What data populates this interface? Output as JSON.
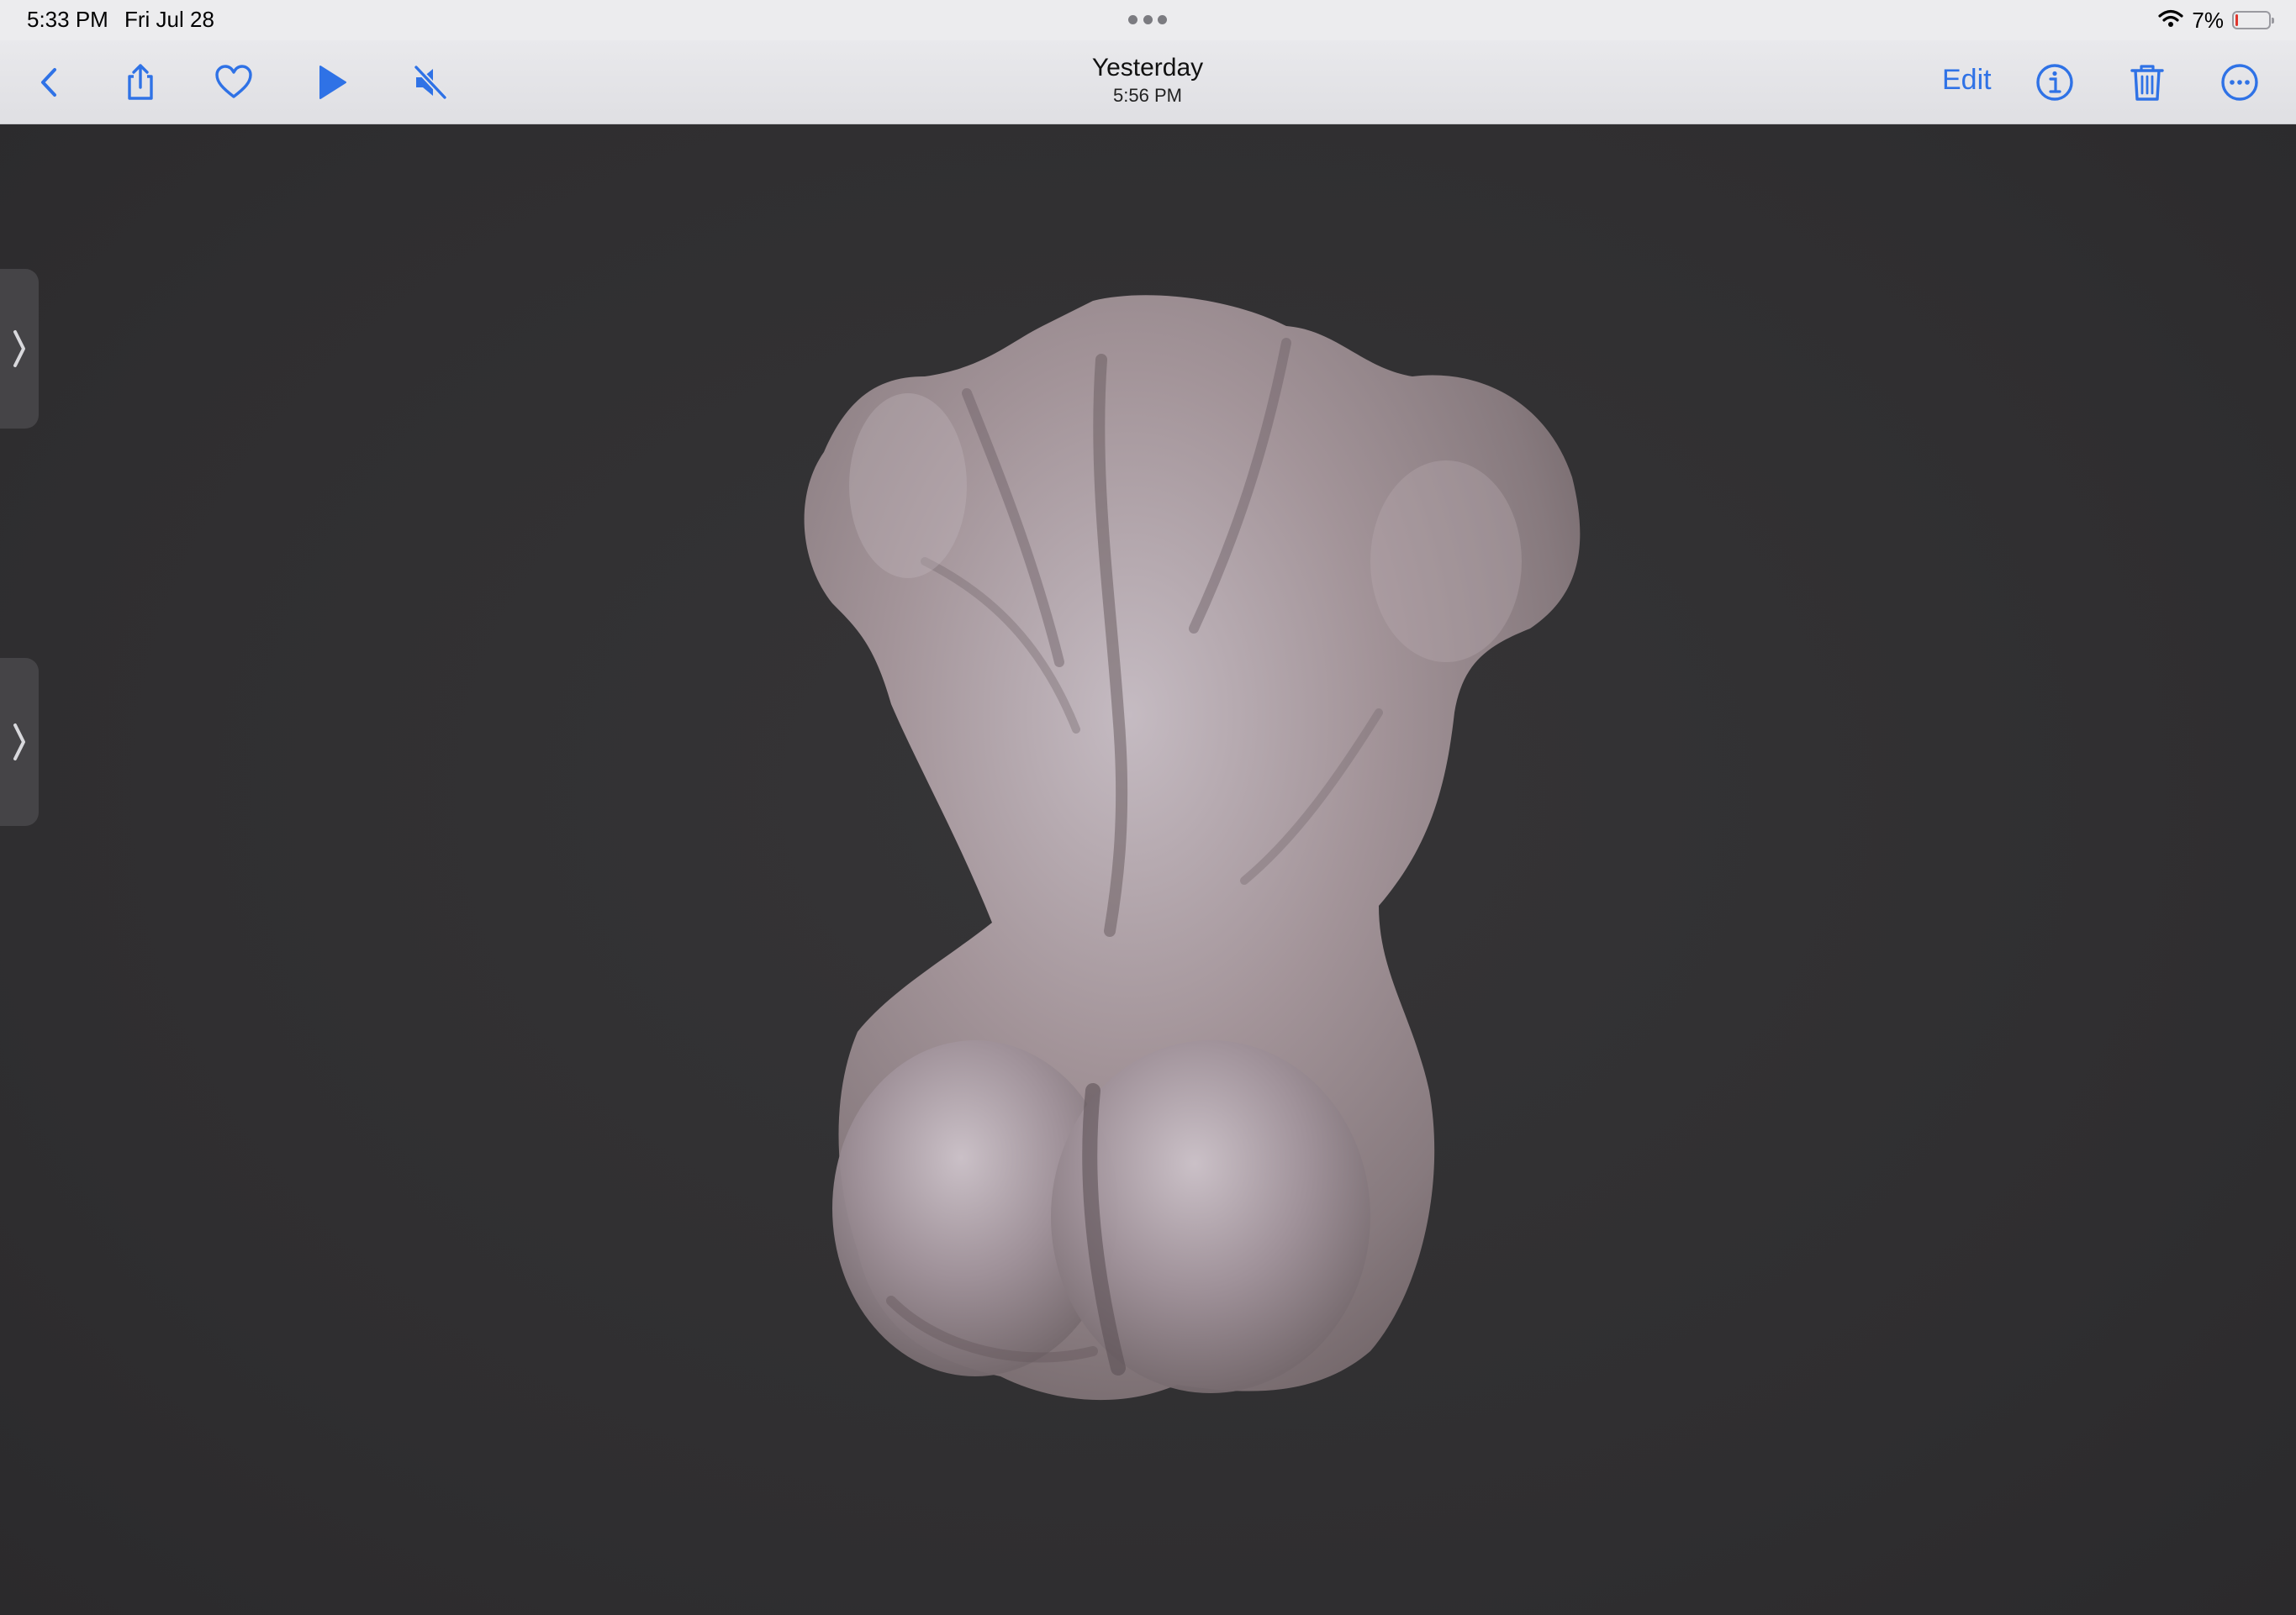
{
  "status_bar": {
    "time": "5:33 PM",
    "date": "Fri Jul 28",
    "battery_percent_text": "7%",
    "battery_level": 0.07,
    "icons": [
      "wifi-icon",
      "battery-icon"
    ]
  },
  "toolbar": {
    "title": "Yesterday",
    "subtitle": "5:56 PM",
    "edit_label": "Edit",
    "left_icons": [
      "back-chevron-icon",
      "share-icon",
      "heart-icon",
      "play-icon",
      "mute-icon"
    ],
    "right_icons": [
      "info-icon",
      "trash-icon",
      "more-icon"
    ]
  },
  "colors": {
    "accent": "#2f72e6",
    "toolbar_bg": "#e6e6e9",
    "viewer_bg": "#323133",
    "model_tone": "#9a8a8c"
  },
  "viewer": {
    "content": "3D sculpture render"
  },
  "side_tabs": [
    "chevron-right-icon",
    "chevron-right-icon"
  ]
}
